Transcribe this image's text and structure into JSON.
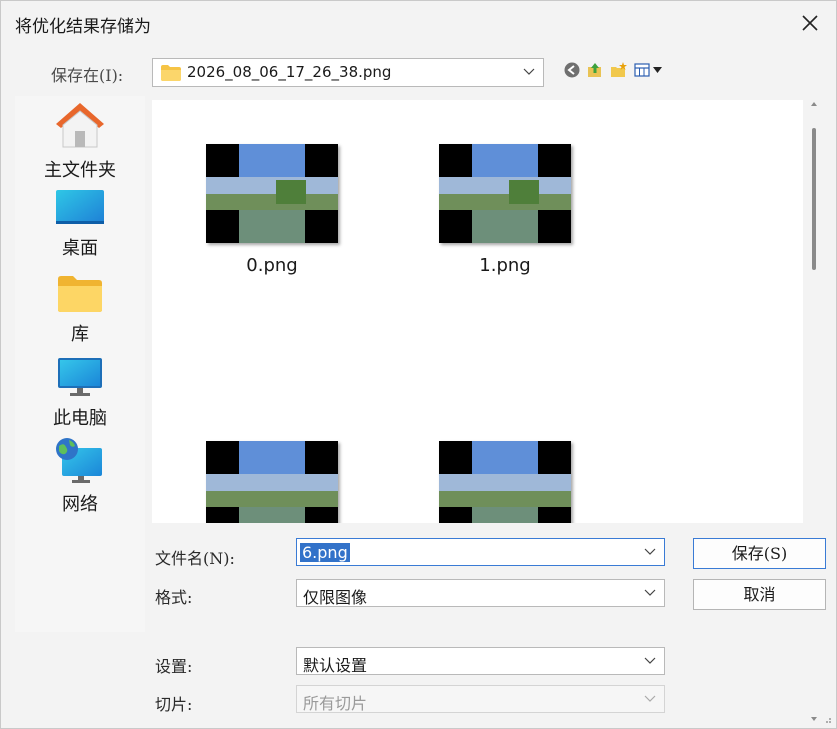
{
  "title": "将优化结果存储为",
  "lookin": {
    "label": "保存在(I):",
    "value": "2026_08_06_17_26_38.png"
  },
  "toolbar": {
    "icons": [
      "back-icon",
      "up-folder-icon",
      "new-folder-icon",
      "view-menu-icon"
    ]
  },
  "places": [
    {
      "label": "主文件夹",
      "icon": "home-icon"
    },
    {
      "label": "桌面",
      "icon": "desktop-icon"
    },
    {
      "label": "库",
      "icon": "library-folder-icon"
    },
    {
      "label": "此电脑",
      "icon": "computer-icon"
    },
    {
      "label": "网络",
      "icon": "network-icon"
    }
  ],
  "files": [
    {
      "name": "0.png"
    },
    {
      "name": "1.png"
    },
    {
      "name": ""
    },
    {
      "name": ""
    }
  ],
  "form": {
    "filename_label": "文件名(N):",
    "filename_value": "6.png",
    "format_label": "格式:",
    "format_value": "仅限图像",
    "settings_label": "设置:",
    "settings_value": "默认设置",
    "slices_label": "切片:",
    "slices_value": "所有切片"
  },
  "buttons": {
    "save": "保存(S)",
    "cancel": "取消"
  }
}
